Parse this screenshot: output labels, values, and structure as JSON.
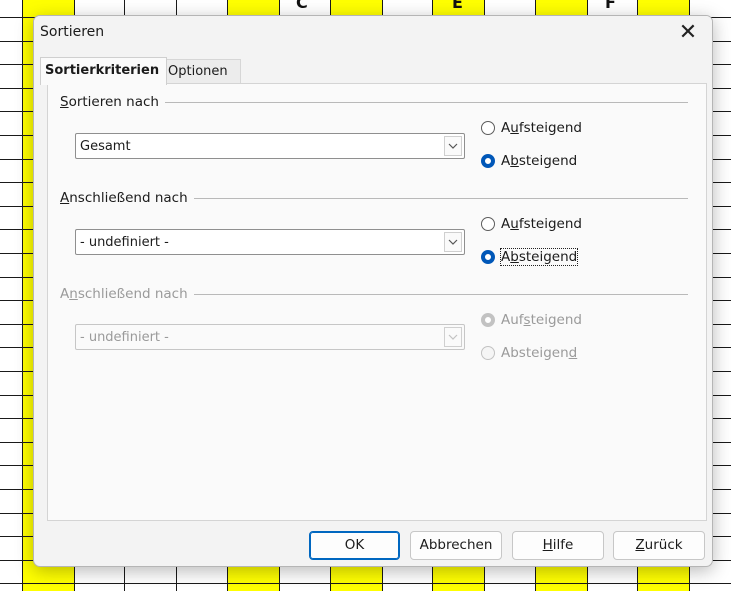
{
  "background": {
    "column_letters": [
      "C",
      "E",
      "F"
    ]
  },
  "dialog": {
    "title": "Sortieren",
    "close_glyph": "✕",
    "tabs": [
      {
        "label": "Sortierkriterien",
        "active": true
      },
      {
        "label": "Optionen",
        "active": false
      }
    ],
    "keys": [
      {
        "label_pre": "",
        "label_u": "S",
        "label_post": "ortieren nach",
        "combo_value": "Gesamt",
        "asc": {
          "pre": "A",
          "u": "u",
          "post": "fsteigend",
          "checked": false
        },
        "desc": {
          "pre": "A",
          "u": "b",
          "post": "steigend",
          "checked": true
        },
        "enabled": true
      },
      {
        "label_pre": "",
        "label_u": "A",
        "label_post": "nschließend nach",
        "combo_value": "- undefiniert -",
        "asc": {
          "pre": "A",
          "u": "u",
          "post": "fsteigend",
          "checked": false
        },
        "desc": {
          "pre": "A",
          "u": "b",
          "post": "steigend",
          "checked": true
        },
        "enabled": true
      },
      {
        "label_pre": "A",
        "label_u": "n",
        "label_post": "schließend nach",
        "combo_value": "- undefiniert -",
        "asc": {
          "pre": "Auf",
          "u": "s",
          "post": "teigend",
          "checked": true
        },
        "desc": {
          "pre": "Absteigen",
          "u": "d",
          "post": "",
          "checked": false
        },
        "enabled": false
      }
    ],
    "buttons": {
      "ok": "OK",
      "cancel": "Abbrechen",
      "help_u": "H",
      "help_rest": "ilfe",
      "reset_u": "Z",
      "reset_rest": "urück"
    }
  },
  "colors": {
    "accent": "#0057b8",
    "cell_highlight": "#ffff00"
  }
}
